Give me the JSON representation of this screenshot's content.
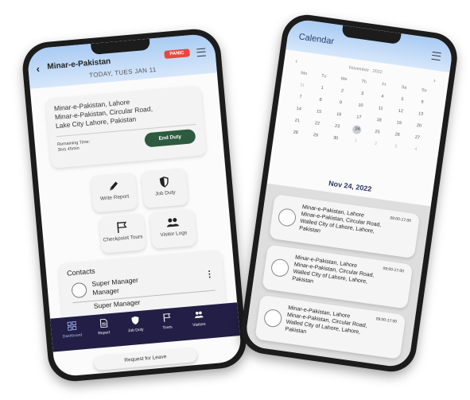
{
  "phone1": {
    "header": {
      "back_glyph": "‹",
      "title": "Minar-e-Pakistan",
      "panic_label": "PANIC",
      "date": "TODAY, TUES JAN 11"
    },
    "location": {
      "line1": "Minar-e-Pakistan, Lahore",
      "line2": "Minar-e-Pakistan, Circular Road,",
      "line3": "Lake City Lahore, Pakistan",
      "remaining_label": "Remaining Time:",
      "remaining_value": "3hrs 45min",
      "end_duty_label": "End Duty"
    },
    "tiles": [
      {
        "label": "Write Report",
        "icon": "pencil-icon"
      },
      {
        "label": "Job Duty",
        "icon": "shield-icon"
      },
      {
        "label": "Checkpoint Tours",
        "icon": "flag-icon"
      },
      {
        "label": "Visitor Logs",
        "icon": "people-icon"
      }
    ],
    "contacts": {
      "title": "Contacts",
      "items": [
        {
          "name": "Super Manager",
          "role": "Manager"
        },
        {
          "name": "Super Manager"
        }
      ]
    },
    "tabbar": [
      {
        "label": "Dashboard",
        "icon": "grid-icon",
        "active": true
      },
      {
        "label": "Report",
        "icon": "document-icon"
      },
      {
        "label": "Job Duty",
        "icon": "shield-icon"
      },
      {
        "label": "Tours",
        "icon": "flag-icon"
      },
      {
        "label": "Visitors",
        "icon": "people-icon"
      }
    ],
    "request_label": "Request for Leave"
  },
  "phone2": {
    "header_title": "Calendar",
    "calendar": {
      "month": "November",
      "year": "2022",
      "prev_glyph": "‹",
      "next_glyph": "›",
      "weekdays": [
        "Mo",
        "Tu",
        "We",
        "Th",
        "Fr",
        "Sa",
        "Su"
      ]
    },
    "selected_date": "Nov 24, 2022",
    "schedule": [
      {
        "time": "09:00-17:00",
        "title": "Minar-e-Pakistan, Lahore",
        "line2": "Minar-e-Pakistan, Circular Road,",
        "line3": "Walled City of Lahore, Lahore,",
        "line4": "Pakistan"
      },
      {
        "time": "09:00-17:00",
        "title": "Minar-e-Pakistan, Lahore",
        "line2": "Minar-e-Pakistan, Circular Road,",
        "line3": "Walled City of Lahore, Lahore,",
        "line4": "Pakistan"
      },
      {
        "time": "09:00-17:00",
        "title": "Minar-e-Pakistan, Lahore",
        "line2": "Minar-e-Pakistan, Circular Road,",
        "line3": "Walled City of Lahore, Lahore,",
        "line4": "Pakistan"
      }
    ]
  }
}
